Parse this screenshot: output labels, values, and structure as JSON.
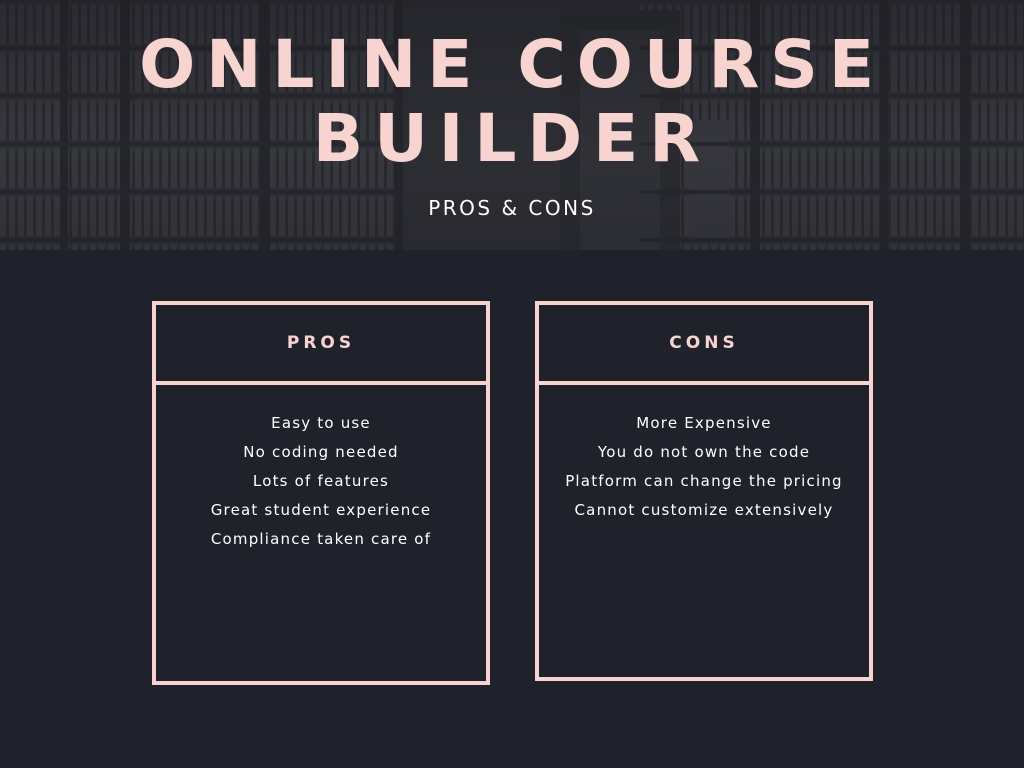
{
  "hero": {
    "title_line1": "ONLINE COURSE",
    "title_line2": "BUILDER",
    "subtitle": "PROS & CONS"
  },
  "pros": {
    "label": "PROS",
    "items": [
      "Easy to use",
      "No coding needed",
      "Lots of features",
      "Great student experience",
      "Compliance taken care of"
    ]
  },
  "cons": {
    "label": "CONS",
    "items": [
      "More Expensive",
      "You do not own the code",
      "Platform can change the pricing",
      "Cannot customize extensively"
    ]
  },
  "colors": {
    "background": "#20222b",
    "accent": "#f8d4d0",
    "text": "#ffffff"
  }
}
